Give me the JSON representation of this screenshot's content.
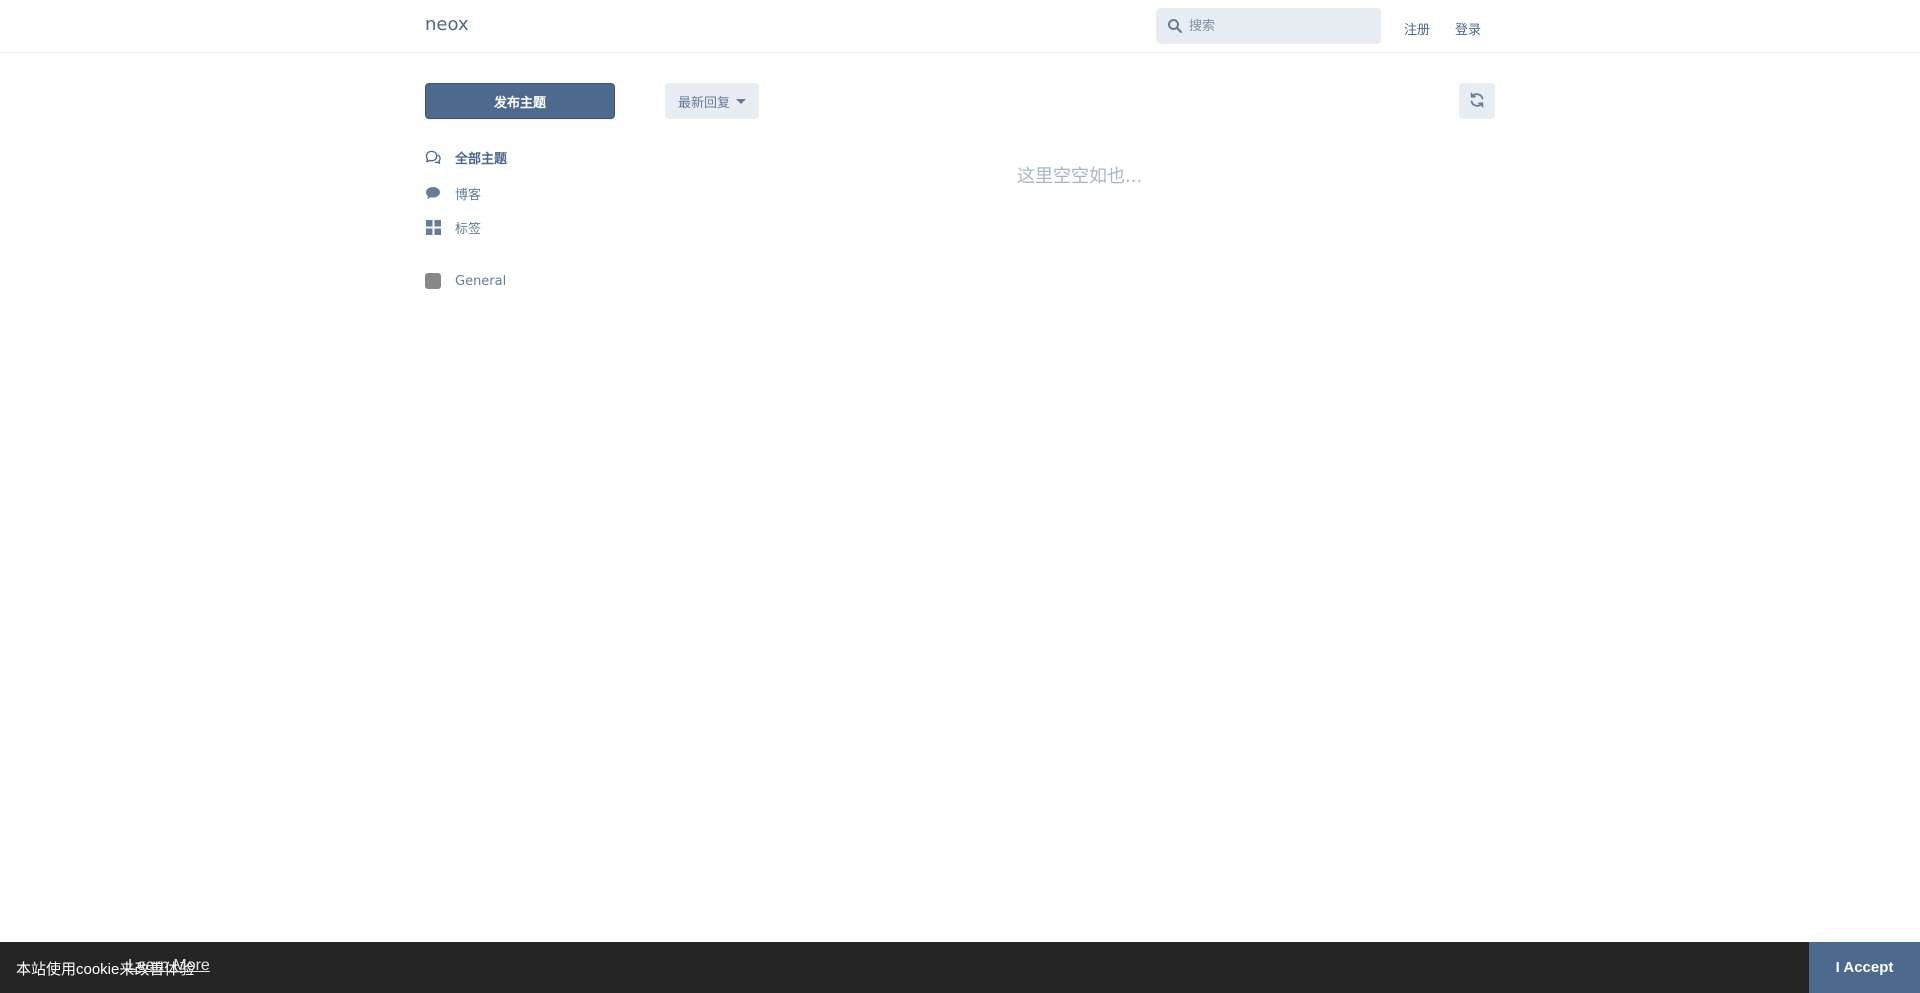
{
  "header": {
    "brand": "neox",
    "search_placeholder": "搜索",
    "signup_label": "注册",
    "login_label": "登录"
  },
  "toolbar": {
    "compose_label": "发布主题",
    "sort_label": "最新回复"
  },
  "sidebar": {
    "items": [
      {
        "label": "全部主题",
        "icon": "comments-icon",
        "active": true
      },
      {
        "label": "博客",
        "icon": "comment-icon",
        "active": false
      },
      {
        "label": "标签",
        "icon": "grid-icon",
        "active": false
      }
    ],
    "tags": [
      {
        "label": "General",
        "color": "#888888"
      }
    ]
  },
  "main": {
    "empty_text": "这里空空如也..."
  },
  "cookie": {
    "message": "本站使用cookie来改善体验",
    "learn_more": "Learn More",
    "accept": "I Accept"
  },
  "colors": {
    "primary": "#4d698e",
    "control_bg": "#e8ecf3",
    "cookie_bg": "#252525"
  }
}
